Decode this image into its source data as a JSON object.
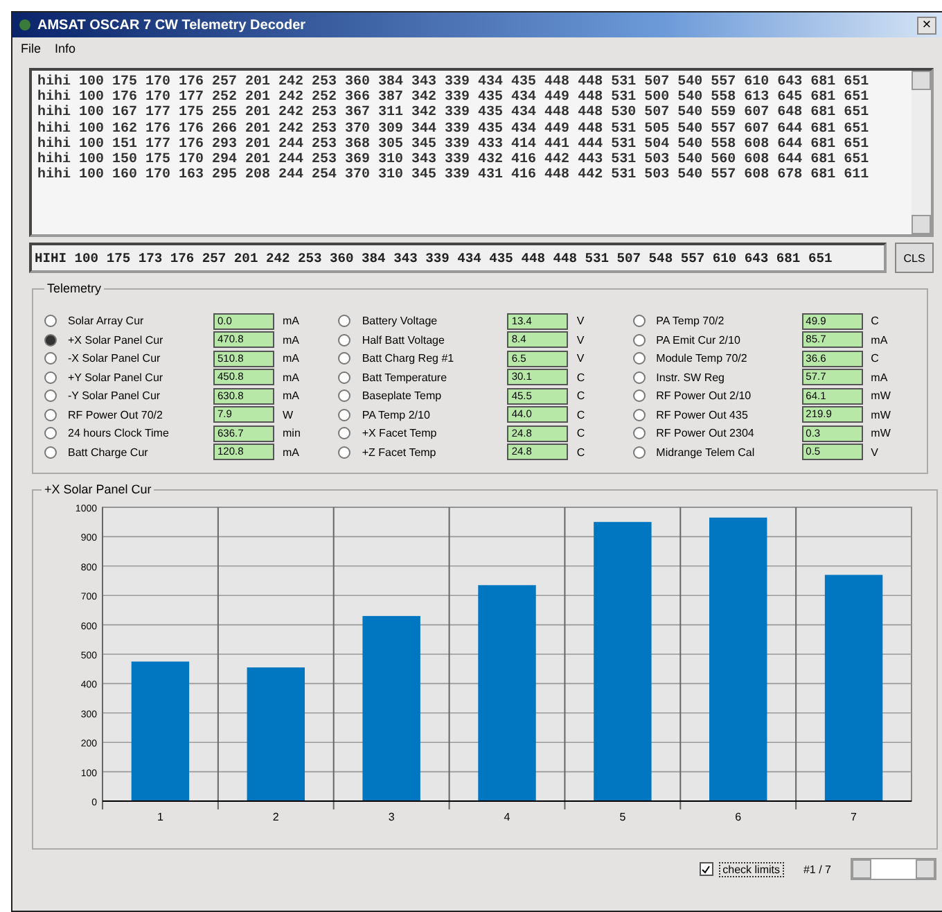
{
  "window": {
    "title": "AMSAT OSCAR 7 CW Telemetry Decoder",
    "close": "×"
  },
  "menu": [
    "File",
    "Info"
  ],
  "log_lines": [
    "hihi 100 175 170 176 257 201 242 253 360 384 343 339 434 435 448 448 531 507 540 557 610 643 681 651",
    "hihi 100 176 170 177 252 201 242 252 366 387 342 339 435 434 449 448 531 500 540 558 613 645 681 651",
    "hihi 100 167 177 175 255 201 242 253 367 311 342 339 435 434 448 448 530 507 540 559 607 648 681 651",
    "hihi 100 162 176 176 266 201 242 253 370 309 344 339 435 434 449 448 531 505 540 557 607 644 681 651",
    "hihi 100 151 177 176 293 201 244 253 368 305 345 339 433 414 441 444 531 504 540 558 608 644 681 651",
    "hihi 100 150 175 170 294 201 244 253 369 310 343 339 432 416 442 443 531 503 540 560 608 644 681 651",
    "hihi 100 160 170 163 295 208 244 254 370 310 345 339 431 416 448 442 531 503 540 557 608 678 681 611"
  ],
  "current_frame": "HIHI 100 175 173 176 257 201 242 253 360 384 343 339 434 435 448 448 531 507 548 557 610 643 681 651",
  "cls_button": "CLS",
  "telemetry": {
    "title": "Telemetry",
    "columns": [
      {
        "items": [
          {
            "label": "Solar Array Cur",
            "value": "0.0",
            "unit": "mA",
            "selected": false
          },
          {
            "label": "+X Solar Panel Cur",
            "value": "470.8",
            "unit": "mA",
            "selected": true
          },
          {
            "label": "-X Solar Panel Cur",
            "value": "510.8",
            "unit": "mA",
            "selected": false
          },
          {
            "label": "+Y Solar Panel Cur",
            "value": "450.8",
            "unit": "mA",
            "selected": false
          },
          {
            "label": "-Y Solar Panel Cur",
            "value": "630.8",
            "unit": "mA",
            "selected": false
          },
          {
            "label": "RF Power Out 70/2",
            "value": "7.9",
            "unit": "W",
            "selected": false
          },
          {
            "label": "24 hours Clock Time",
            "value": "636.7",
            "unit": "min",
            "selected": false
          },
          {
            "label": "Batt Charge Cur",
            "value": "120.8",
            "unit": "mA",
            "selected": false
          }
        ]
      },
      {
        "items": [
          {
            "label": "Battery Voltage",
            "value": "13.4",
            "unit": "V",
            "selected": false
          },
          {
            "label": "Half Batt Voltage",
            "value": "8.4",
            "unit": "V",
            "selected": false
          },
          {
            "label": "Batt Charg Reg #1",
            "value": "6.5",
            "unit": "V",
            "selected": false
          },
          {
            "label": "Batt Temperature",
            "value": "30.1",
            "unit": "C",
            "selected": false
          },
          {
            "label": "Baseplate Temp",
            "value": "45.5",
            "unit": "C",
            "selected": false
          },
          {
            "label": "PA Temp 2/10",
            "value": "44.0",
            "unit": "C",
            "selected": false
          },
          {
            "label": "+X Facet Temp",
            "value": "24.8",
            "unit": "C",
            "selected": false
          },
          {
            "label": "+Z Facet Temp",
            "value": "24.8",
            "unit": "C",
            "selected": false
          }
        ]
      },
      {
        "items": [
          {
            "label": "PA Temp 70/2",
            "value": "49.9",
            "unit": "C",
            "selected": false
          },
          {
            "label": "PA Emit Cur 2/10",
            "value": "85.7",
            "unit": "mA",
            "selected": false
          },
          {
            "label": "Module Temp 70/2",
            "value": "36.6",
            "unit": "C",
            "selected": false
          },
          {
            "label": "Instr. SW Reg",
            "value": "57.7",
            "unit": "mA",
            "selected": false
          },
          {
            "label": "RF Power Out 2/10",
            "value": "64.1",
            "unit": "mW",
            "selected": false
          },
          {
            "label": "RF Power Out 435",
            "value": "219.9",
            "unit": "mW",
            "selected": false
          },
          {
            "label": "RF Power Out 2304",
            "value": "0.3",
            "unit": "mW",
            "selected": false
          },
          {
            "label": "Midrange Telem Cal",
            "value": "0.5",
            "unit": "V",
            "selected": false
          }
        ]
      }
    ]
  },
  "chart": {
    "title": "+X Solar Panel Cur",
    "chart_data": {
      "type": "bar",
      "categories": [
        "1",
        "2",
        "3",
        "4",
        "5",
        "6",
        "7"
      ],
      "grid": true,
      "series": [
        {
          "color": "#0077c0",
          "values": [
            475,
            455,
            630,
            735,
            950,
            965,
            770
          ]
        }
      ],
      "ylim": [
        0,
        1000
      ],
      "yticks": [
        0,
        100,
        200,
        300,
        400,
        500,
        600,
        700,
        800,
        900,
        1000
      ]
    }
  },
  "footer": {
    "check_limits": {
      "label": "check limits",
      "checked": true
    },
    "counter": "#1 / 7"
  }
}
